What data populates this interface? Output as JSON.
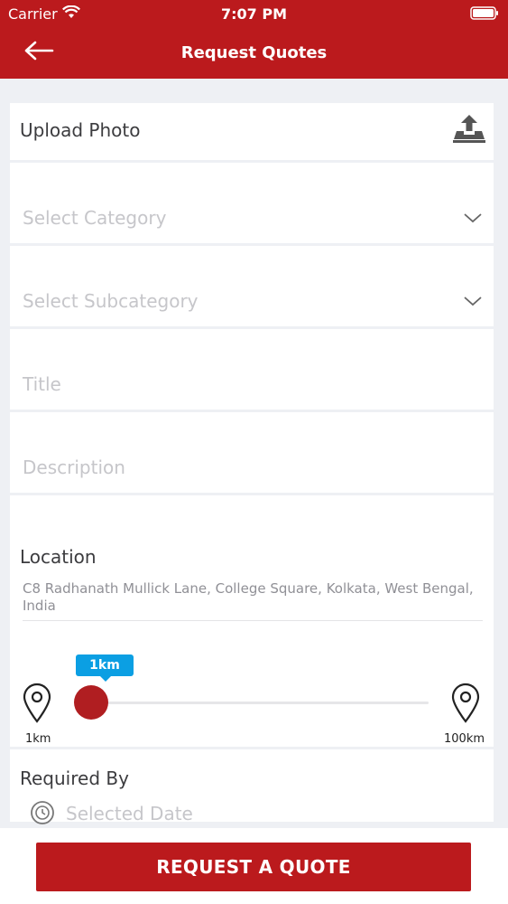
{
  "status_bar": {
    "carrier": "Carrier",
    "time": "7:07 PM"
  },
  "header": {
    "title": "Request Quotes",
    "back_icon": "arrow-left-icon"
  },
  "colors": {
    "brand": "#bb1a1d",
    "accent": "#0b9fe3",
    "knob": "#b01e21"
  },
  "form": {
    "upload_label": "Upload Photo",
    "category_placeholder": "Select Category",
    "subcategory_placeholder": "Select Subcategory",
    "title_placeholder": "Title",
    "description_placeholder": "Description",
    "location_label": "Location",
    "location_address": "C8 Radhanath Mullick Lane, College Square, Kolkata, West Bengal, India",
    "radius": {
      "value_label": "1km",
      "min_label": "1km",
      "max_label": "100km",
      "value_km": 1
    },
    "required_by_label": "Required By",
    "date_placeholder": "Selected Date"
  },
  "cta": {
    "label": "REQUEST A QUOTE"
  }
}
